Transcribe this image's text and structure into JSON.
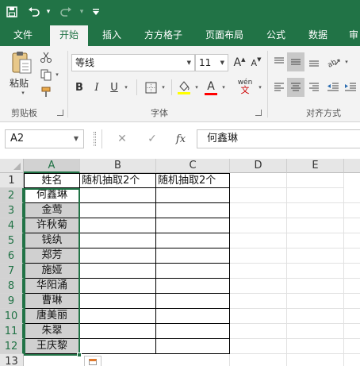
{
  "quick_access": {
    "save_icon": "save-icon",
    "undo_icon": "undo-icon",
    "redo_icon": "redo-icon",
    "customize_icon": "customize-qat-icon"
  },
  "tabs": [
    {
      "label": "文件",
      "active": false
    },
    {
      "label": "开始",
      "active": true
    },
    {
      "label": "插入",
      "active": false
    },
    {
      "label": "方方格子",
      "active": false
    },
    {
      "label": "页面布局",
      "active": false
    },
    {
      "label": "公式",
      "active": false
    },
    {
      "label": "数据",
      "active": false
    },
    {
      "label": "审",
      "active": false
    }
  ],
  "ribbon": {
    "clipboard": {
      "group_label": "剪贴板",
      "paste_label": "粘贴"
    },
    "font": {
      "group_label": "字体",
      "font_name": "等线",
      "font_size": "11",
      "bold": "B",
      "italic": "I",
      "underline": "U",
      "grow_label": "A",
      "shrink_label": "A",
      "font_color_label": "A",
      "phonetic_label": "wén",
      "fill_color": "#ffff00",
      "font_color": "#ff0000"
    },
    "alignment": {
      "group_label": "对齐方式"
    }
  },
  "formula_bar": {
    "name_box": "A2",
    "fx_label": "fx",
    "formula": "何鑫琳"
  },
  "sheet": {
    "columns": [
      "A",
      "B",
      "C",
      "D",
      "E"
    ],
    "rows": [
      "1",
      "2",
      "3",
      "4",
      "5",
      "6",
      "7",
      "8",
      "9",
      "10",
      "11",
      "12",
      "13"
    ],
    "header_row": [
      "姓名",
      "随机抽取2个",
      "随机抽取2个"
    ],
    "names": [
      "何鑫琳",
      "金莺",
      "许秋菊",
      "钱纨",
      "郑芳",
      "施娅",
      "华阳涌",
      "曹琳",
      "唐美丽",
      "朱翠",
      "王庆黎"
    ]
  },
  "colors": {
    "accent": "#217346",
    "selected_fill": "#d0d0d0"
  }
}
